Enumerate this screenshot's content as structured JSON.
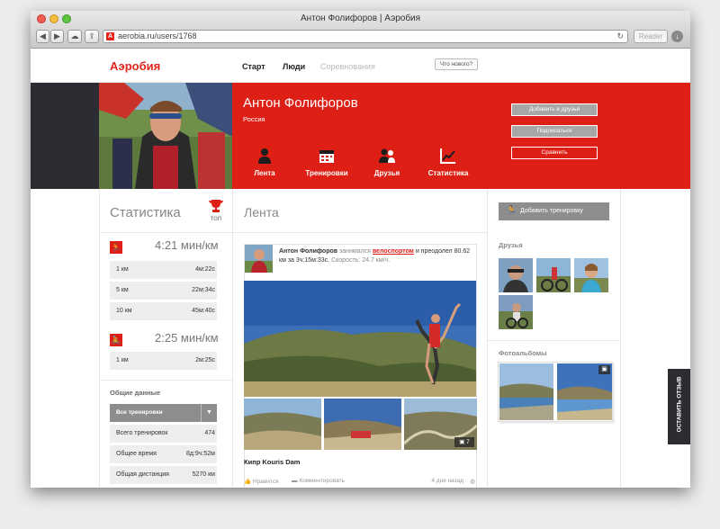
{
  "window": {
    "title": "Антон Фолифоров | Аэробия",
    "url": "aerobia.ru/users/1768",
    "reader_label": "Reader"
  },
  "nav": {
    "logo": "Аэробия",
    "links": [
      "Старт",
      "Люди",
      "Соревнования"
    ],
    "whats_new": "Что нового?"
  },
  "profile": {
    "name": "Антон Фолифоров",
    "country": "Россия",
    "tabs": [
      {
        "label": "Лента",
        "icon": "person-icon"
      },
      {
        "label": "Тренировки",
        "icon": "calendar-icon"
      },
      {
        "label": "Друзья",
        "icon": "friends-icon"
      },
      {
        "label": "Статистика",
        "icon": "chart-icon"
      }
    ],
    "actions": {
      "add_friend": "Добавить в друзья",
      "subscribe": "Подписаться",
      "compare": "Сравнить"
    }
  },
  "stats": {
    "title": "Статистика",
    "top_label": "ТОП",
    "running": {
      "pace": "4:21 мин/км",
      "rows": [
        {
          "dist": "1 км",
          "time": "4м:22с"
        },
        {
          "dist": "5 км",
          "time": "22м:34с"
        },
        {
          "dist": "10 км",
          "time": "45м:40с"
        }
      ]
    },
    "cycling": {
      "pace": "2:25 мин/км",
      "rows": [
        {
          "dist": "1 км",
          "time": "2м:25с"
        }
      ]
    },
    "general": {
      "title": "Общие данные",
      "filter": "Все тренировки",
      "rows": [
        {
          "label": "Всего тренировок",
          "value": "474"
        },
        {
          "label": "Общее время",
          "value": "8д:9ч:52м"
        },
        {
          "label": "Общая дистанция",
          "value": "5270 км"
        }
      ]
    }
  },
  "feed": {
    "title": "Лента",
    "post": {
      "author": "Антон Фолифоров",
      "verb": "занимался",
      "sport": "велоспортом",
      "rest": "и преодолел",
      "line2": "80.62 км за 3ч:15м:33с.",
      "speed": "Скорость: 24.7 км/ч.",
      "photo_count": "7",
      "caption": "Кипр Kouris Dam",
      "like": "Нравится",
      "comment": "Комментировать",
      "time": "4 дня назад"
    }
  },
  "sidebar": {
    "add_training": "Добавить тренировку",
    "friends_title": "Друзья",
    "albums_title": "Фотоальбомы",
    "feedback": "ОСТАВИТЬ ОТЗЫВ"
  },
  "colors": {
    "brand": "#dd1f16",
    "dark": "#2c2d33"
  }
}
